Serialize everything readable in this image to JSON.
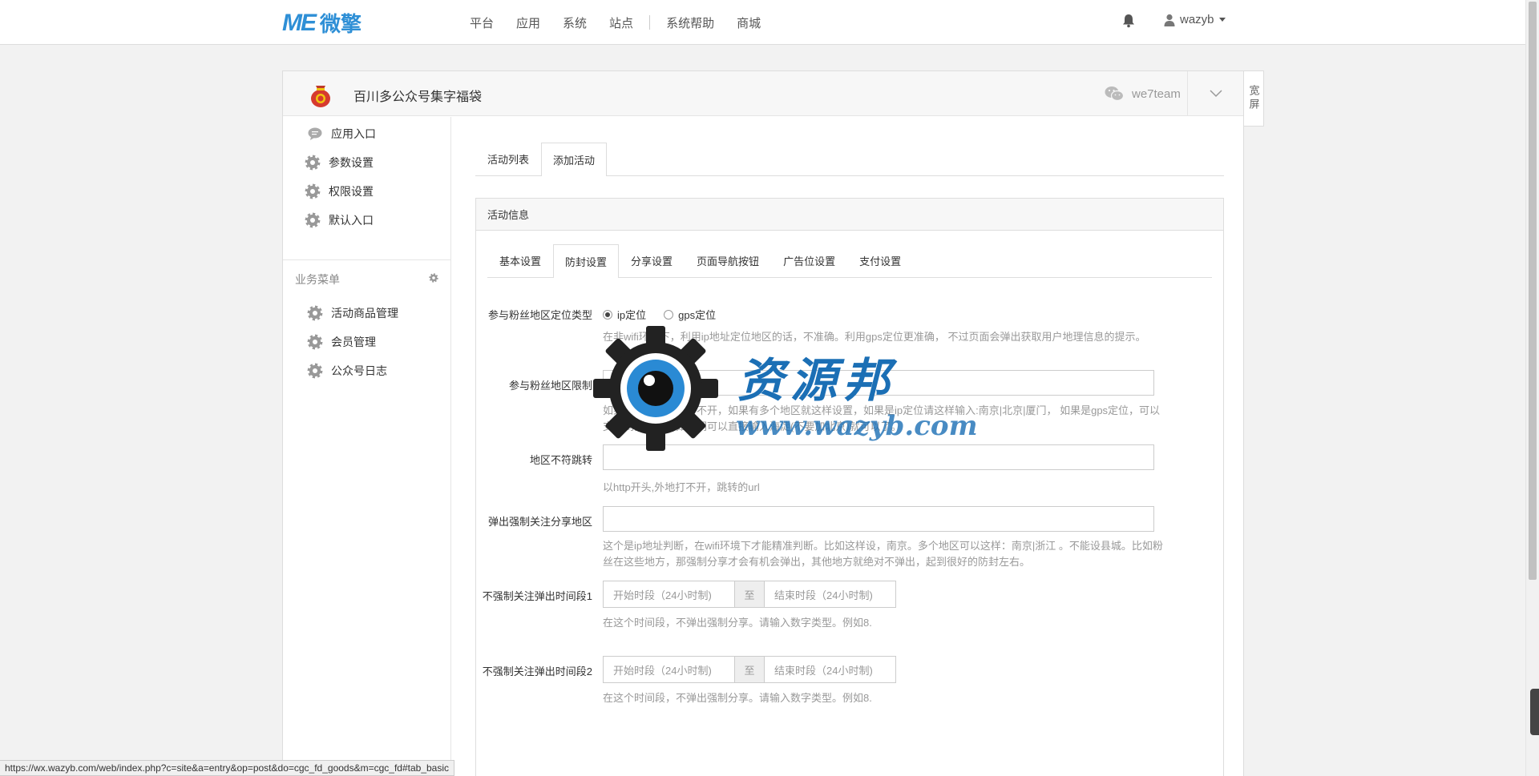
{
  "brand": {
    "logo_mark": "ME",
    "logo_name": "微擎"
  },
  "topnav": {
    "items": [
      "平台",
      "应用",
      "系统",
      "站点"
    ],
    "items2": [
      "系统帮助",
      "商城"
    ],
    "user": "wazyb"
  },
  "module": {
    "title": "百川多公众号集字福袋",
    "account": "we7team",
    "wide_screen": "宽屏"
  },
  "sidebar": {
    "items": [
      {
        "label": "应用入口",
        "icon": "chat-bubble-icon"
      },
      {
        "label": "参数设置",
        "icon": "gear-icon"
      },
      {
        "label": "权限设置",
        "icon": "gear-icon"
      },
      {
        "label": "默认入口",
        "icon": "gear-icon"
      }
    ],
    "group_title": "业务菜单",
    "group_items": [
      {
        "label": "活动商品管理",
        "icon": "gear-icon"
      },
      {
        "label": "会员管理",
        "icon": "gear-icon"
      },
      {
        "label": "公众号日志",
        "icon": "gear-icon"
      }
    ]
  },
  "content": {
    "top_tabs": [
      "活动列表",
      "添加活动"
    ],
    "top_tab_active": "添加活动",
    "box_title": "活动信息",
    "inner_tabs": [
      "基本设置",
      "防封设置",
      "分享设置",
      "页面导航按钮",
      "广告位设置",
      "支付设置"
    ],
    "inner_tab_active": "防封设置",
    "fields": {
      "locate_type": {
        "label": "参与粉丝地区定位类型",
        "options": [
          "ip定位",
          "gps定位"
        ],
        "selected": "ip定位",
        "help": "在非wifi环境下，利用ip地址定位地区的话，不准确。利用gps定位更准确， 不过页面会弹出获取用户地理信息的提示。"
      },
      "region_limit": {
        "label": "参与粉丝地区限制",
        "value": "",
        "help": "如果设置了则外地打不开，如果有多个地区就这样设置，如果是ip定位请这样输入:南京|北京|厦门， 如果是gps定位，可以支持到区县，比如你们可以直接输入海淀(不要加北京)就可以了。"
      },
      "region_redirect": {
        "label": "地区不符跳转",
        "value": "",
        "help": "以http开头,外地打不开，跳转的url"
      },
      "force_follow_region": {
        "label": "弹出强制关注分享地区",
        "value": "",
        "help": "这个是ip地址判断，在wifi环境下才能精准判断。比如这样设，南京。多个地区可以这样：南京|浙江 。不能设县城。比如粉丝在这些地方，那强制分享才会有机会弹出，其他地方就绝对不弹出，起到很好的防封左右。"
      },
      "no_force_period1": {
        "label": "不强制关注弹出时间段1",
        "start_placeholder": "开始时段（24小时制)",
        "to": "至",
        "end_placeholder": "结束时段（24小时制)",
        "help": "在这个时间段，不弹出强制分享。请输入数字类型。例如8."
      },
      "no_force_period2": {
        "label": "不强制关注弹出时间段2",
        "start_placeholder": "开始时段（24小时制)",
        "to": "至",
        "end_placeholder": "结束时段（24小时制)",
        "help": "在这个时间段，不弹出强制分享。请输入数字类型。例如8."
      }
    }
  },
  "watermark": {
    "text": "资源邦",
    "url": "www.wazyb.com"
  },
  "status_bar": "https://wx.wazyb.com/web/index.php?c=site&a=entry&op=post&do=cgc_fd_goods&m=cgc_fd#tab_basic",
  "colors": {
    "brand": "#2e8fd6",
    "watermark": "#1b6fb5"
  }
}
